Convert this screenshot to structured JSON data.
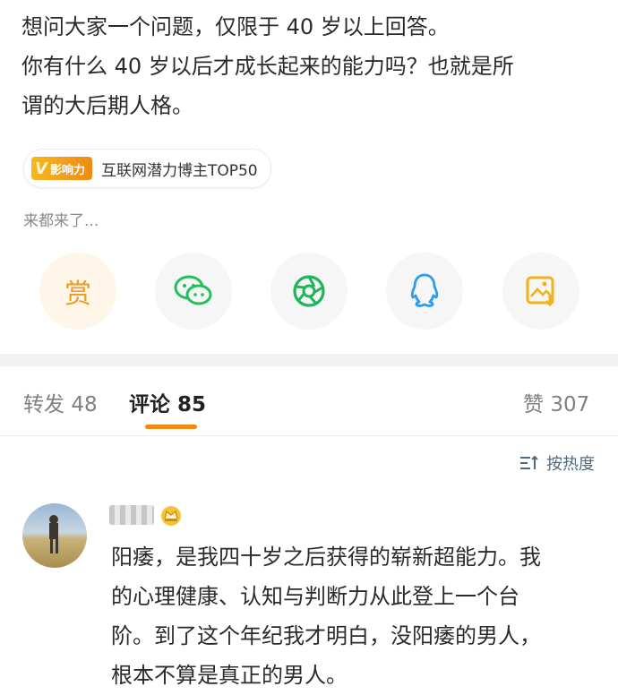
{
  "post": {
    "lines": [
      "想问大家一个问题，仅限于 40 岁以上回答。",
      "你有什么 40 岁以后才成长起来的能力吗？也就是所",
      "谓的大后期人格。"
    ]
  },
  "badge": {
    "logo_text": "影响力",
    "logo_letter": "V",
    "label": "互联网潜力博主TOP50"
  },
  "visitors": "来都来了...",
  "share": {
    "reward_label": "赏",
    "icons": [
      "reward-icon",
      "wechat-icon",
      "moments-icon",
      "qq-icon",
      "save-image-icon"
    ]
  },
  "tabs": {
    "repost_label": "转发",
    "repost_count": "48",
    "comment_label": "评论",
    "comment_count": "85",
    "like_label": "赞",
    "like_count": "307"
  },
  "sort": {
    "label": "按热度"
  },
  "comment": {
    "lines": [
      "阳痿，是我四十岁之后获得的崭新超能力。我",
      "的心理健康、认知与判断力从此登上一个台",
      "阶。到了这个年纪我才明白，没阳痿的男人，",
      "根本不算是真正的男人。"
    ]
  },
  "colors": {
    "accent": "#f08a14",
    "wechat": "#22c05a",
    "moments": "#1fb55a",
    "qq": "#2d9bf0",
    "save": "#f2b21b"
  }
}
